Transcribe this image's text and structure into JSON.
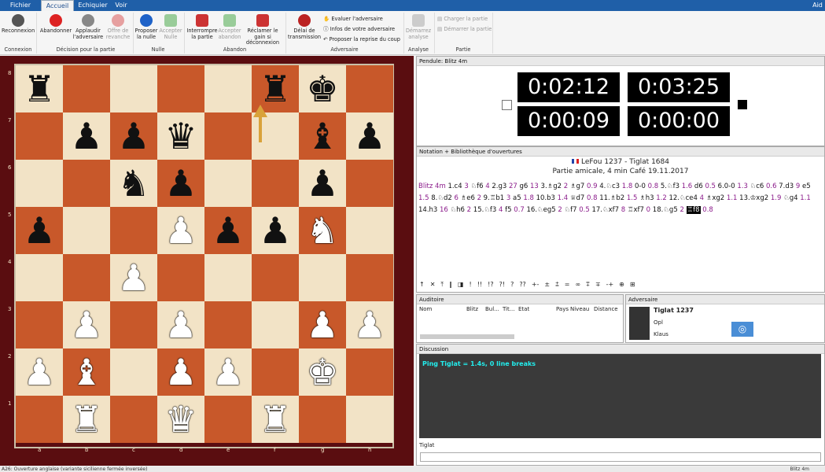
{
  "tabs": {
    "file": "Fichier",
    "home": "Accueil",
    "chess": "Echiquier",
    "view": "Voir",
    "help": "Aid"
  },
  "ribbon": {
    "connection": {
      "reconnect": "Reconnexion",
      "group": "Connexion"
    },
    "decision": {
      "resign": "Abandonner",
      "applaud": "Applaudir l'adversaire",
      "rematch": "Offre de revanche",
      "group": "Décision pour la partie"
    },
    "draw": {
      "propose": "Proposer la nulle",
      "accept": "Accepter Nulle",
      "group": "Nulle"
    },
    "abandon": {
      "interrupt": "Interrompre la partie",
      "accept": "Accepter abandon",
      "claim": "Réclamer le gain si déconnexion",
      "group": "Abandon"
    },
    "opponent": {
      "delay": "Délai de transmission",
      "evaluate": "Evaluer l'adversaire",
      "info": "Infos de votre adversaire",
      "retake": "Proposer la reprise du coup",
      "group": "Adversaire"
    },
    "analysis": {
      "start": "Démarrez analyse",
      "group": "Analyse"
    },
    "game": {
      "load": "Charger la partie",
      "start": "Démarrer la partie",
      "group": "Partie"
    }
  },
  "board": {
    "ranks": [
      "8",
      "7",
      "6",
      "5",
      "4",
      "3",
      "2",
      "1"
    ],
    "files": [
      "a",
      "b",
      "c",
      "d",
      "e",
      "f",
      "g",
      "h"
    ],
    "position": [
      [
        "br",
        "",
        "",
        "",
        "",
        "br",
        "bk",
        ""
      ],
      [
        "",
        "bp",
        "bp",
        "bq",
        "",
        "",
        "bb",
        "bp"
      ],
      [
        "",
        "",
        "bn",
        "bp",
        "",
        "",
        "bp",
        ""
      ],
      [
        "bp",
        "",
        "",
        "wp",
        "bp",
        "bp",
        "wn",
        ""
      ],
      [
        "",
        "",
        "wp",
        "",
        "",
        "",
        "",
        ""
      ],
      [
        "",
        "wp",
        "",
        "wp",
        "",
        "",
        "wp",
        "wp"
      ],
      [
        "wp",
        "wb",
        "",
        "wp",
        "wp",
        "",
        "wk",
        ""
      ],
      [
        "",
        "wr",
        "",
        "wq",
        "",
        "wr",
        "",
        ""
      ]
    ]
  },
  "clock": {
    "title": "Pendule: Blitz 4m",
    "top_left": "0:02:12",
    "top_right": "0:03:25",
    "bottom_left": "0:00:09",
    "bottom_right": "0:00:00"
  },
  "notation": {
    "title": "Notation + Bibliothèque d'ouvertures",
    "players": "LeFou 1237 - Tiglat 1684",
    "event": "Partie amicale, 4 min Café 19.11.2017"
  },
  "symbols": [
    "↑",
    "✕",
    "⤒",
    "‖",
    "◨",
    "!",
    "!!",
    "!?",
    "?!",
    "?",
    "??",
    "+-",
    "±",
    "⩲",
    "=",
    "∞",
    "⩱",
    "∓",
    "-+",
    "⊕",
    "⊞"
  ],
  "audience": {
    "title": "Auditoire",
    "cols": [
      "Nom",
      "Blitz",
      "Bul...",
      "Tit...",
      "Etat",
      "Pays",
      "Niveau",
      "Distance"
    ]
  },
  "opponent": {
    "title": "Adversaire",
    "name": "Tiglat 1237",
    "line2": "Opl",
    "line3": "Klaus"
  },
  "discussion": {
    "title": "Discussion",
    "message": "Ping Tiglat = 1.4s, 0 line breaks",
    "input_label": "Tiglat"
  },
  "status": {
    "text": "A26: Ouverture anglaise (variante sicilienne fermée inversée)",
    "right": "Blitz 4m"
  }
}
